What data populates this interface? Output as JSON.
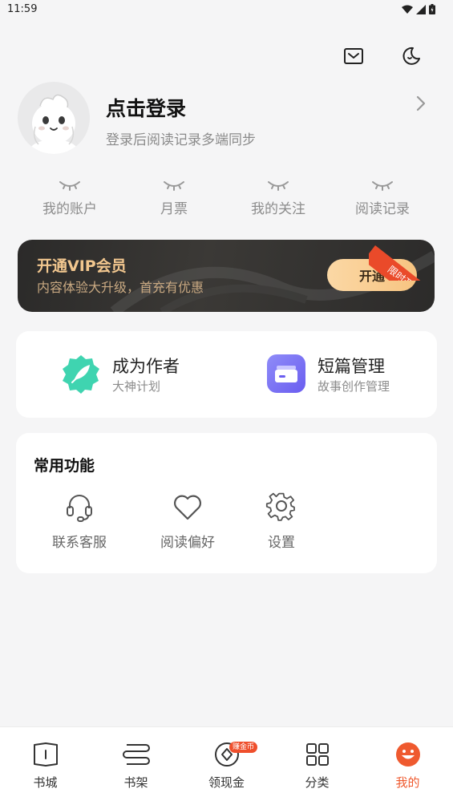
{
  "status_bar": {
    "time": "11:59"
  },
  "profile": {
    "title": "点击登录",
    "subtitle": "登录后阅读记录多端同步"
  },
  "stats": [
    {
      "label": "我的账户"
    },
    {
      "label": "月票"
    },
    {
      "label": "我的关注"
    },
    {
      "label": "阅读记录"
    }
  ],
  "vip": {
    "title": "开通VIP会员",
    "subtitle": "内容体验大升级，首充有优惠",
    "button": "开通",
    "ribbon": "限时开通"
  },
  "creator": [
    {
      "title": "成为作者",
      "subtitle": "大神计划"
    },
    {
      "title": "短篇管理",
      "subtitle": "故事创作管理"
    }
  ],
  "functions": {
    "title": "常用功能",
    "items": [
      {
        "label": "联系客服"
      },
      {
        "label": "阅读偏好"
      },
      {
        "label": "设置"
      }
    ]
  },
  "tabbar": {
    "items": [
      {
        "label": "书城"
      },
      {
        "label": "书架"
      },
      {
        "label": "领现金",
        "badge": "赚金币"
      },
      {
        "label": "分类"
      },
      {
        "label": "我的"
      }
    ],
    "active": "我的"
  },
  "colors": {
    "accent": "#ef5a2f",
    "vip_gold": "#f2c78f",
    "background": "#f5f5f6"
  }
}
